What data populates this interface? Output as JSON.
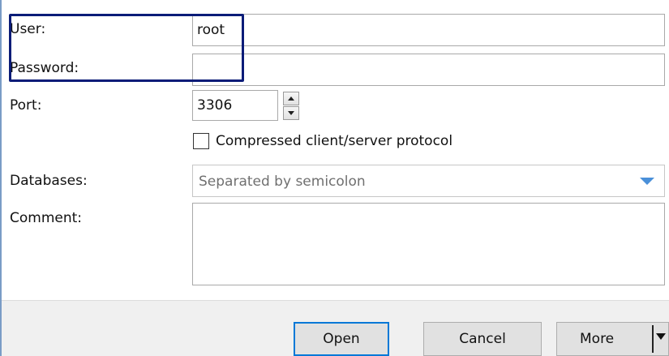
{
  "form": {
    "user": {
      "label": "User:",
      "value": "root"
    },
    "password": {
      "label": "Password:",
      "value": ""
    },
    "port": {
      "label": "Port:",
      "value": "3306"
    },
    "compressed": {
      "label": "Compressed client/server protocol",
      "checked": false
    },
    "databases": {
      "label": "Databases:",
      "placeholder": "Separated by semicolon"
    },
    "comment": {
      "label": "Comment:",
      "value": ""
    }
  },
  "buttons": {
    "open": "Open",
    "cancel": "Cancel",
    "more": "More"
  },
  "icons": {
    "spin_up": "triangle-up-icon",
    "spin_down": "triangle-down-icon",
    "combo_dropdown": "chevron-down-icon",
    "more_dropdown": "caret-down-icon"
  },
  "colors": {
    "highlight_border": "#0b1c78",
    "default_button_border": "#0078d7",
    "combo_arrow": "#4a90d9"
  }
}
